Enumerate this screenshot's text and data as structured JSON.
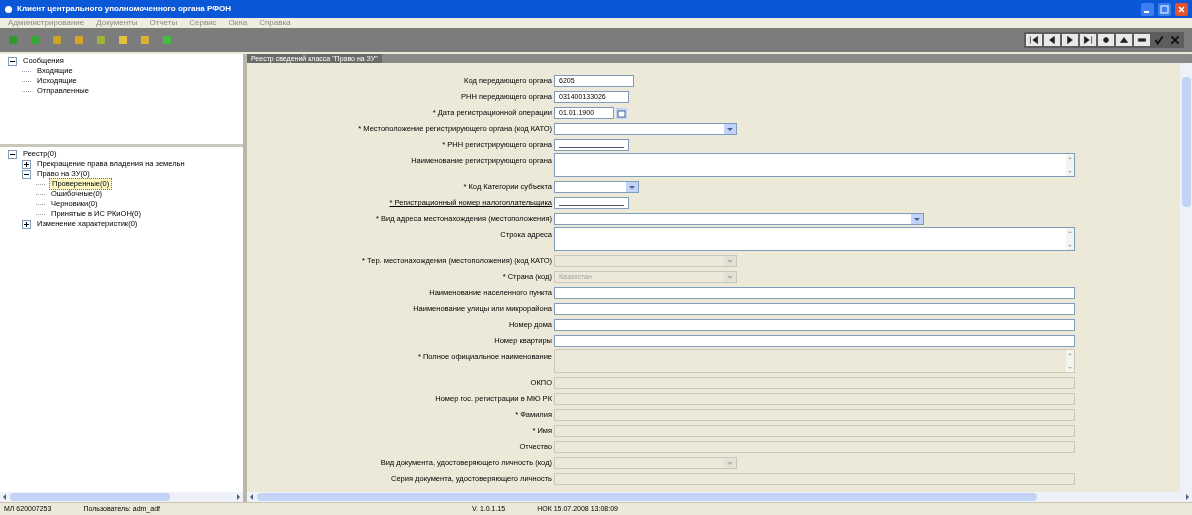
{
  "window": {
    "title": "Клиент центрального уполномоченного органа РФОН"
  },
  "menu": [
    "Администрирование",
    "Документы",
    "Отчеты",
    "Сервис",
    "Окна",
    "Справка"
  ],
  "messages_tree": [
    {
      "label": "Сообщения",
      "expanded": true,
      "selected": false,
      "children": [
        {
          "label": "Входящие",
          "selected": false
        },
        {
          "label": "Исходящие",
          "selected": false
        },
        {
          "label": "Отправленные",
          "selected": false
        }
      ]
    }
  ],
  "registry_tree": [
    {
      "label": "Реестр(0)",
      "expanded": true,
      "selected": false,
      "children": [
        {
          "label": "Прекращение права владения на земельн",
          "expanded": false,
          "selected": false
        },
        {
          "label": "Право на ЗУ(0)",
          "expanded": true,
          "selected": false,
          "children": [
            {
              "label": "Проверенные(0)",
              "selected": true
            },
            {
              "label": "Ошибочные(0)",
              "selected": false
            },
            {
              "label": "Черновики(0)",
              "selected": false
            },
            {
              "label": "Принятые в ИС РКиОН(0)",
              "selected": false
            }
          ]
        },
        {
          "label": "Изменение характеристик(0)",
          "expanded": false,
          "selected": false
        }
      ]
    }
  ],
  "panel": {
    "title": "Реестр сведений класса \"Право на ЗУ\""
  },
  "fields": [
    {
      "label": "Код передающего органа",
      "kind": "text",
      "value": "6205",
      "disabled": false,
      "underlined": false
    },
    {
      "label": "РНН передающего органа",
      "kind": "text",
      "value": "031400133026",
      "disabled": false,
      "underlined": false
    },
    {
      "label": "* Дата регистрационной операции",
      "kind": "date",
      "value": "01.01.1900",
      "disabled": false,
      "underlined": false
    },
    {
      "label": "* Местоположение регистрирующего органа (код КАТО)",
      "kind": "combo",
      "disabled": false,
      "underlined": false
    },
    {
      "label": "* РНН регистрирующего органа",
      "kind": "mask",
      "disabled": false,
      "underlined": false
    },
    {
      "label": "Наименование регистрирующего органа",
      "kind": "textarea",
      "disabled": false,
      "underlined": false
    },
    {
      "label": "* Код Категории субъекта",
      "kind": "combo",
      "disabled": false,
      "underlined": false
    },
    {
      "label": "* Регистрационный номер налогоплательщика",
      "kind": "mask",
      "disabled": false,
      "underlined": true
    },
    {
      "label": "* Вид адреса местонахождения (местоположения)",
      "kind": "combo",
      "disabled": false,
      "underlined": false
    },
    {
      "label": "Строка адреса",
      "kind": "textarea",
      "disabled": false,
      "underlined": false
    },
    {
      "label": "* Тер. местонахождения (местоположения) (код КАТО)",
      "kind": "combo",
      "disabled": true,
      "underlined": false
    },
    {
      "label": "* Страна (код)",
      "kind": "combo",
      "value": "Казахстан",
      "disabled": true,
      "underlined": false
    },
    {
      "label": "Наименование населенного пункта",
      "kind": "text",
      "disabled": false,
      "underlined": false
    },
    {
      "label": "Наименование улицы или микрорайона",
      "kind": "text",
      "disabled": false,
      "underlined": false
    },
    {
      "label": "Номер дома",
      "kind": "text",
      "disabled": false,
      "underlined": false
    },
    {
      "label": "Номер квартиры",
      "kind": "text",
      "disabled": false,
      "underlined": false
    },
    {
      "label": "* Полное официальное наименование",
      "kind": "textarea",
      "disabled": true,
      "underlined": false
    },
    {
      "label": "ОКПО",
      "kind": "text",
      "disabled": true,
      "underlined": false
    },
    {
      "label": "Номер гос. регистрации в МЮ РК",
      "kind": "text",
      "disabled": true,
      "underlined": false
    },
    {
      "label": "* Фамилия",
      "kind": "text",
      "disabled": true,
      "underlined": false
    },
    {
      "label": "* Имя",
      "kind": "text",
      "disabled": true,
      "underlined": false
    },
    {
      "label": "Отчество",
      "kind": "text",
      "disabled": true,
      "underlined": false
    },
    {
      "label": "Вид документа, удостоверяющего личность (код)",
      "kind": "combo",
      "disabled": true,
      "underlined": false
    },
    {
      "label": "Серия документа, удостоверяющего личность",
      "kind": "text",
      "disabled": true,
      "underlined": false
    }
  ],
  "status_bar": [
    "МЛ 620007253",
    "Пользователь: adm_adf",
    "V. 1.0.1.15",
    "НОК 15.07.2008 13:08:09"
  ]
}
